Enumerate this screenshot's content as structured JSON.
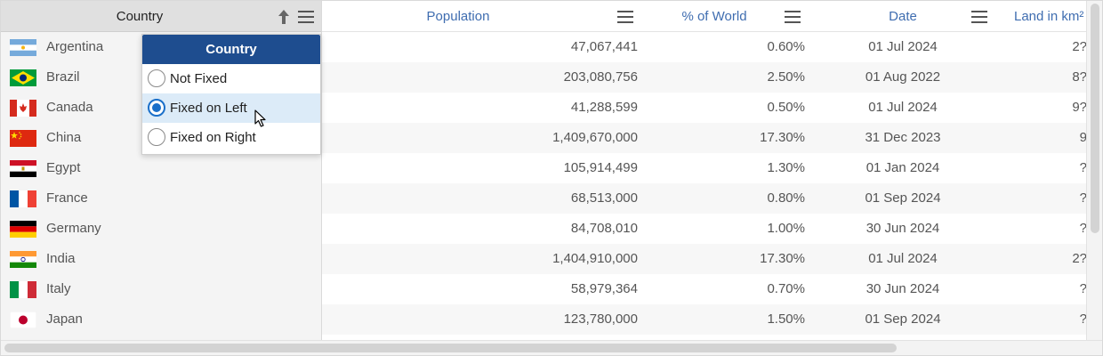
{
  "frozen_column": {
    "header": "Country",
    "pin_icon": "pin-up-arrow-icon",
    "menu_icon": "hamburger-menu-icon"
  },
  "columns": [
    {
      "label": "Population"
    },
    {
      "label": "% of World"
    },
    {
      "label": "Date"
    },
    {
      "label": "Land in km²"
    }
  ],
  "rows": [
    {
      "country": "Argentina",
      "flag": "flag-argentina-icon",
      "population": "47,067,441",
      "percent": "0.60%",
      "date": "01 Jul 2024",
      "land": "2?"
    },
    {
      "country": "Brazil",
      "flag": "flag-brazil-icon",
      "population": "203,080,756",
      "percent": "2.50%",
      "date": "01 Aug 2022",
      "land": "8?"
    },
    {
      "country": "Canada",
      "flag": "flag-canada-icon",
      "population": "41,288,599",
      "percent": "0.50%",
      "date": "01 Jul 2024",
      "land": "9?"
    },
    {
      "country": "China",
      "flag": "flag-china-icon",
      "population": "1,409,670,000",
      "percent": "17.30%",
      "date": "31 Dec 2023",
      "land": "9"
    },
    {
      "country": "Egypt",
      "flag": "flag-egypt-icon",
      "population": "105,914,499",
      "percent": "1.30%",
      "date": "01 Jan 2024",
      "land": "?"
    },
    {
      "country": "France",
      "flag": "flag-france-icon",
      "population": "68,513,000",
      "percent": "0.80%",
      "date": "01 Sep 2024",
      "land": "?"
    },
    {
      "country": "Germany",
      "flag": "flag-germany-icon",
      "population": "84,708,010",
      "percent": "1.00%",
      "date": "30 Jun 2024",
      "land": "?"
    },
    {
      "country": "India",
      "flag": "flag-india-icon",
      "population": "1,404,910,000",
      "percent": "17.30%",
      "date": "01 Jul 2024",
      "land": "2?"
    },
    {
      "country": "Italy",
      "flag": "flag-italy-icon",
      "population": "58,979,364",
      "percent": "0.70%",
      "date": "30 Jun 2024",
      "land": "?"
    },
    {
      "country": "Japan",
      "flag": "flag-japan-icon",
      "population": "123,780,000",
      "percent": "1.50%",
      "date": "01 Sep 2024",
      "land": "?"
    }
  ],
  "popup": {
    "title": "Country",
    "options": [
      {
        "label": "Not Fixed",
        "selected": false
      },
      {
        "label": "Fixed on Left",
        "selected": true
      },
      {
        "label": "Fixed on Right",
        "selected": false
      }
    ]
  },
  "colors": {
    "header_text": "#3f6db0",
    "popup_title_bg": "#1e4d8f",
    "radio_selected": "#1a6fc9",
    "selected_row": "#dcebf8"
  }
}
